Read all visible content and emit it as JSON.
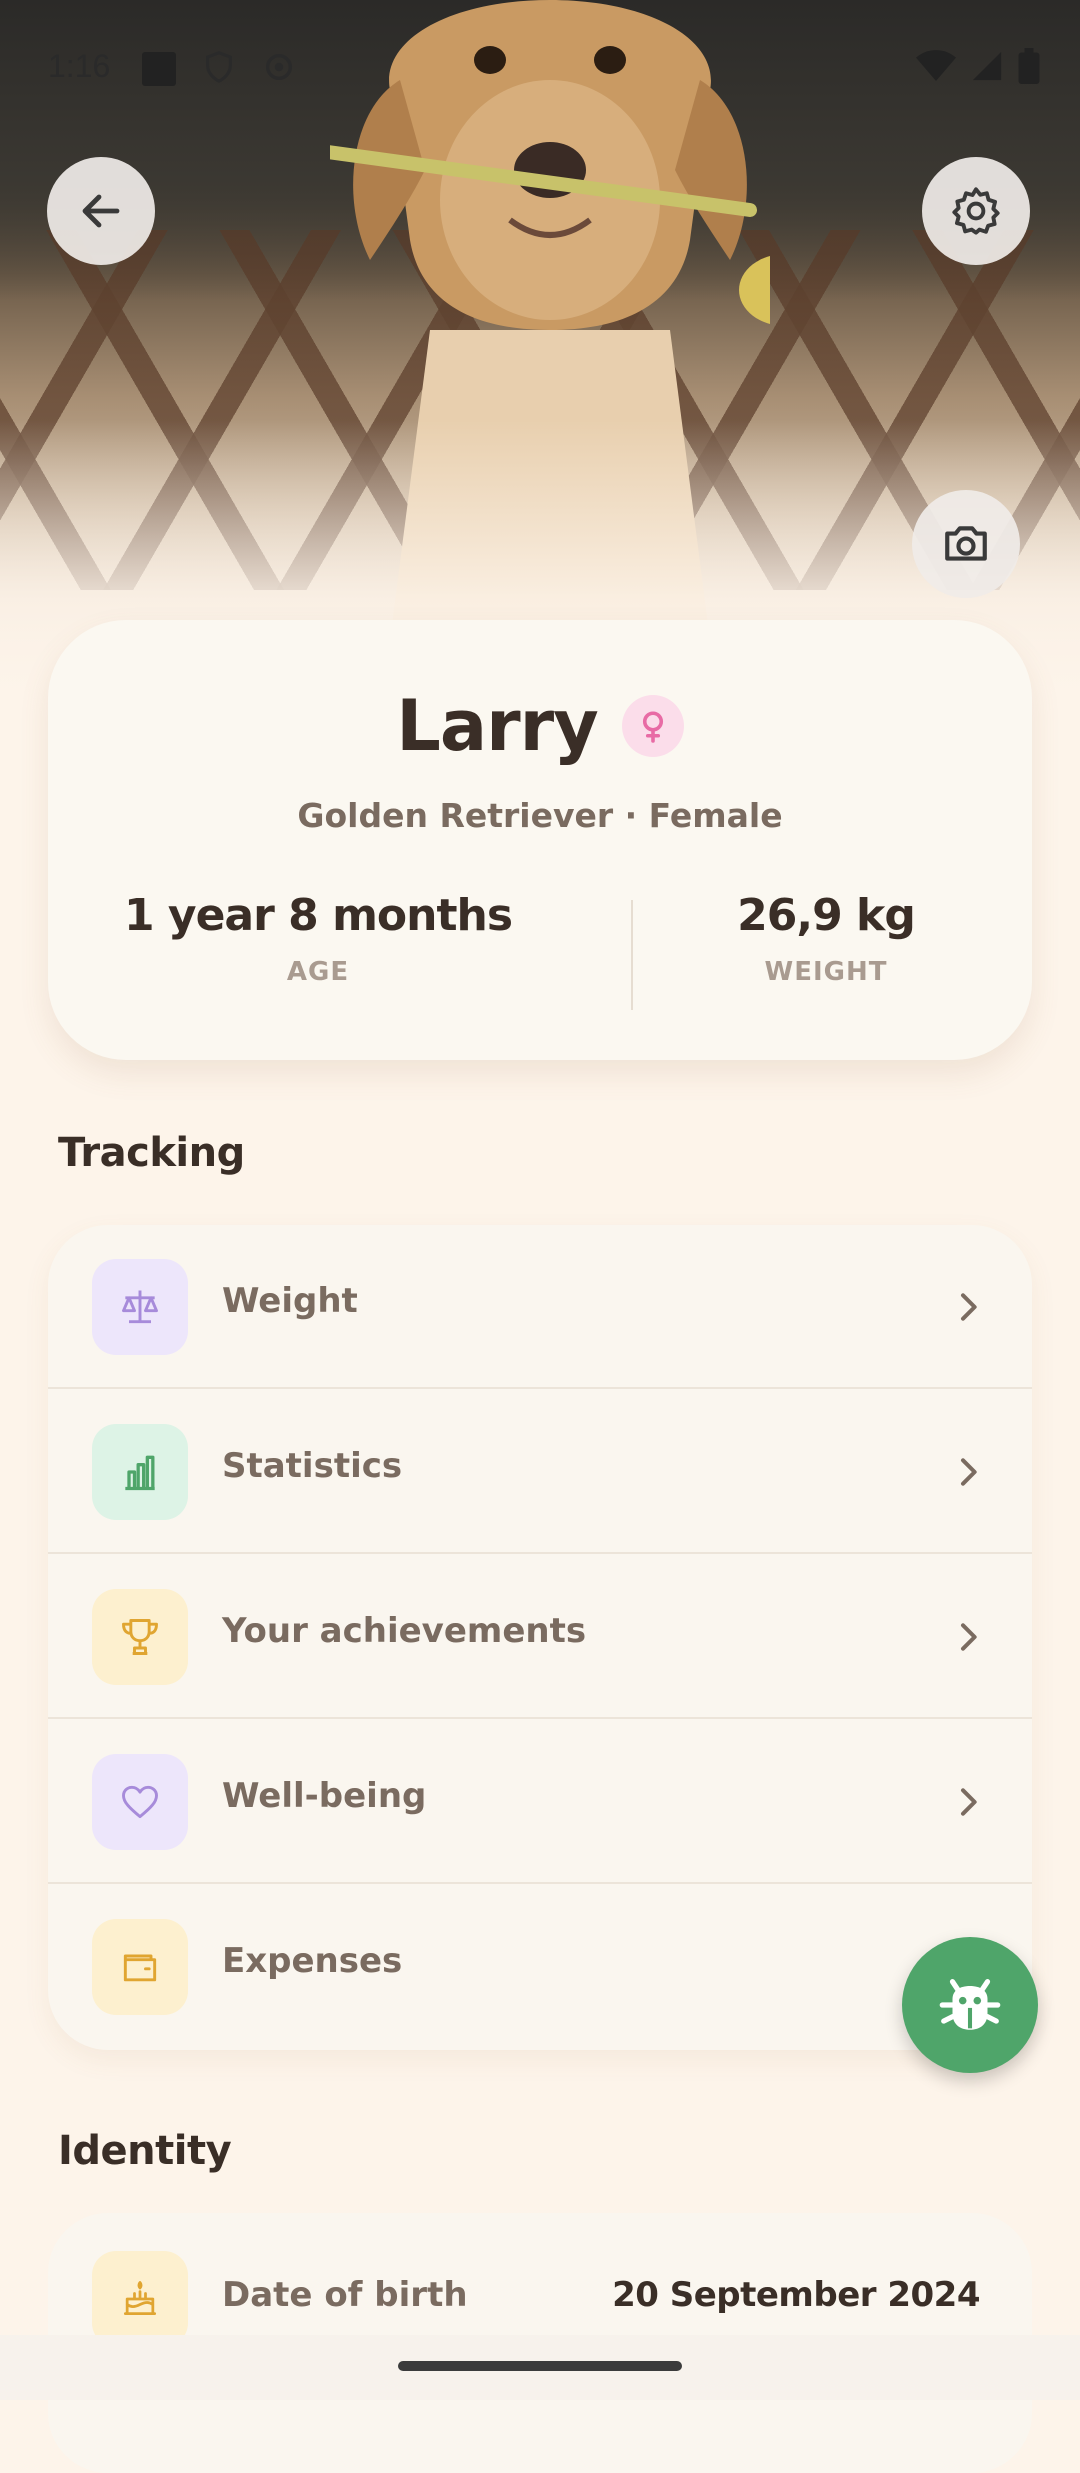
{
  "status_bar": {
    "time": "1:16"
  },
  "profile": {
    "name": "Larry",
    "subtitle": "Golden Retriever · Female",
    "age_value": "1 year 8 months",
    "age_label": "AGE",
    "weight_value": "26,9 kg",
    "weight_label": "WEIGHT"
  },
  "tracking": {
    "title": "Tracking",
    "items": [
      {
        "label": "Weight",
        "icon": "scale-icon",
        "icon_bg": "#EDE6FB",
        "icon_color": "#A78BDA"
      },
      {
        "label": "Statistics",
        "icon": "bar-chart-icon",
        "icon_bg": "#DDF3E6",
        "icon_color": "#4FA56A"
      },
      {
        "label": "Your achievements",
        "icon": "trophy-icon",
        "icon_bg": "#FDF0CF",
        "icon_color": "#E0A531"
      },
      {
        "label": "Well-being",
        "icon": "heart-icon",
        "icon_bg": "#EDE6FB",
        "icon_color": "#A78BDA"
      },
      {
        "label": "Expenses",
        "icon": "wallet-icon",
        "icon_bg": "#FDF0CF",
        "icon_color": "#E0A531"
      }
    ]
  },
  "identity": {
    "title": "Identity",
    "date_of_birth_label": "Date of birth",
    "date_of_birth_value": "20 September 2024"
  },
  "colors": {
    "accent_green": "#4FA56A",
    "background": "#FDF4EA",
    "card": "#FBF8F1",
    "female_pink": "#E86BA5"
  }
}
